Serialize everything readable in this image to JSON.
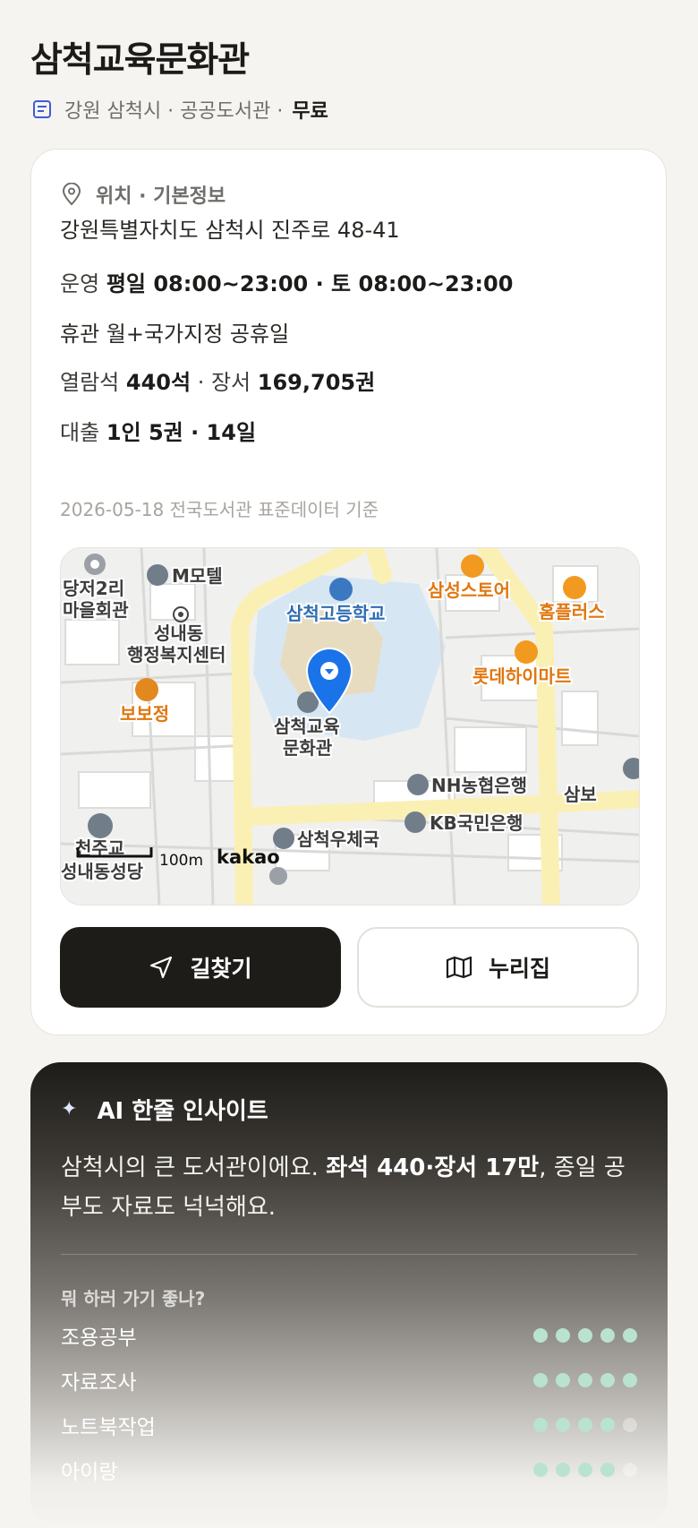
{
  "header": {
    "title": "삼척교육문화관",
    "meta_prefix": "강원 삼척시 · 공공도서관 ·",
    "fee": "무료"
  },
  "info": {
    "section_title": "위치 · 기본정보",
    "address": "강원특별자치도 삼척시 진주로 48-41",
    "hours_label": "운영",
    "hours_value": "평일 08:00~23:00 · 토 08:00~23:00",
    "closed": "휴관 월+국가지정 공휴일",
    "seats_label": "열람석",
    "seats_value": "440석",
    "books_label": "· 장서",
    "books_value": "169,705권",
    "loan_label": "대출",
    "loan_value": "1인 5권 · 14일",
    "source": "2026-05-18 전국도서관 표준데이터 기준"
  },
  "map": {
    "labels": {
      "danji": "당저2리",
      "danji2": "마을회관",
      "motel": "M모텔",
      "school": "삼척고등학교",
      "samsung": "삼성스토어",
      "homeplus": "홈플러스",
      "sungnae1": "성내동",
      "sungnae2": "행정복지센터",
      "lotte": "롯데하이마트",
      "bobo": "보보정",
      "lib1": "삼척교육",
      "lib2": "문화관",
      "nh": "NH농협은행",
      "kb": "KB국민은행",
      "sambo": "삼보",
      "post": "삼척우체국",
      "cheonju": "천주교",
      "cathedral": "성내동성당",
      "scale": "100m",
      "brand": "kakao"
    }
  },
  "buttons": {
    "directions": "길찾기",
    "nurizip": "누리집"
  },
  "ai": {
    "title": "AI 한줄 인사이트",
    "text_a": "삼척시의 큰 도서관이에요. ",
    "text_b": "좌석 440·장서 17만",
    "text_c": ", 종일 공부도 자료도 넉넉해요.",
    "question": "뭐 하러 가기 좋나?",
    "activities": [
      {
        "name": "조용공부",
        "score": 5
      },
      {
        "name": "자료조사",
        "score": 5
      },
      {
        "name": "노트북작업",
        "score": 4
      },
      {
        "name": "아이랑",
        "score": 4
      }
    ]
  },
  "colors": {
    "accent_dark": "#1e1c19",
    "dot_on": "#b9e3cf",
    "map_pin": "#1a73e8",
    "poi_orange": "#f29a1f"
  }
}
